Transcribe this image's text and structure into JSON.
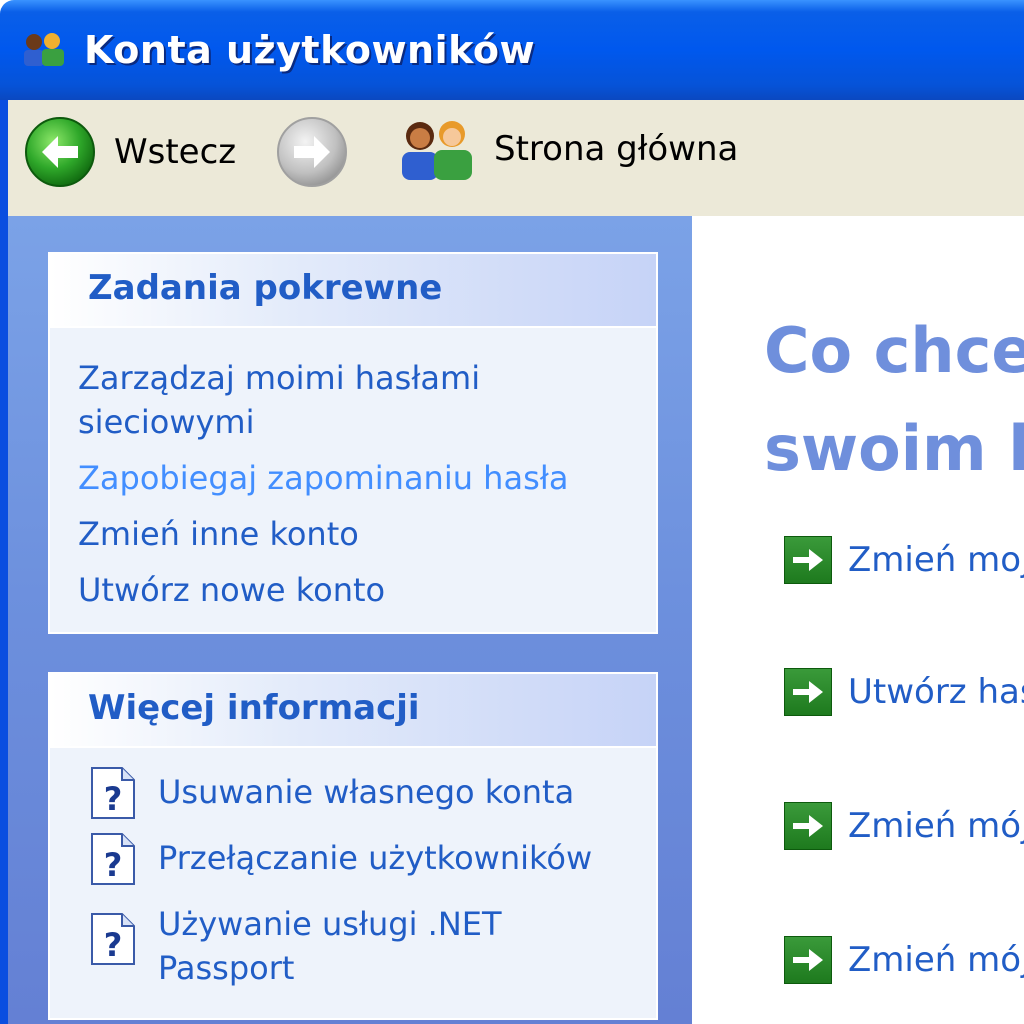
{
  "window": {
    "title": "Konta użytkowników"
  },
  "toolbar": {
    "back_label": "Wstecz",
    "home_label": "Strona główna"
  },
  "related_tasks": {
    "title": "Zadania pokrewne",
    "items": [
      "Zarządzaj moimi hasłami sieciowymi",
      "Zapobiegaj zapominaniu hasła",
      "Zmień inne konto",
      "Utwórz nowe konto"
    ]
  },
  "more_info": {
    "title": "Więcej informacji",
    "items": [
      "Usuwanie własnego konta",
      "Przełączanie użytkowników",
      "Używanie usługi .NET Passport"
    ]
  },
  "main": {
    "heading_line1": "Co chce",
    "heading_line2": "swoim k",
    "tasks": [
      "Zmień moja",
      "Utwórz has",
      "Zmień mój o",
      "Zmień mój l"
    ]
  },
  "colors": {
    "title_bar": "#0058ee",
    "link": "#215dc6",
    "link_hover": "#428eff",
    "heading": "#6f8fdc",
    "task_pane": "#7ba2e7",
    "toolbar": "#ece9d8"
  },
  "icons": {
    "title": "users-icon",
    "back": "back-arrow-icon",
    "forward": "forward-arrow-icon",
    "home": "users-home-icon",
    "help": "help-document-icon",
    "task": "green-arrow-icon"
  }
}
